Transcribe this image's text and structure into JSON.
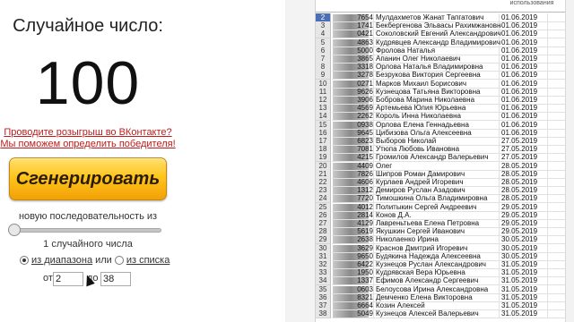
{
  "left": {
    "title": "Случайное число:",
    "result": "100",
    "link1": "Проводите розыгрыш во ВКонтакте?",
    "link2": "Мы поможем определить победителя!",
    "generate_label": "Сгенерировать",
    "sequence_label": "новую последовательность из",
    "count_label": "1 случайного числа",
    "radio_range_label": "из диапазона",
    "radio_or": "или",
    "radio_list_label": "из списка",
    "from_label": "от",
    "from_value": "2",
    "to_label": "до",
    "to_value": "38"
  },
  "sheet": {
    "header_date": "использования",
    "rows": [
      {
        "n": "2",
        "code": "7654",
        "name": "Мулдахметов Жанат Тапгатович",
        "date": "01.06.2019",
        "selected": true
      },
      {
        "n": "3",
        "code": "1741",
        "name": "Бекбергенова Эльвасы Рахимжановна",
        "date": "01.06.2019"
      },
      {
        "n": "4",
        "code": "0421",
        "name": "Соколовский Евгений Александрович",
        "date": "01.06.2019"
      },
      {
        "n": "5",
        "code": "4863",
        "name": "Кудрявцев Александр Владимирович",
        "date": "01.06.2019"
      },
      {
        "n": "6",
        "code": "5000",
        "name": "Фролова Наталья",
        "date": "01.06.2019"
      },
      {
        "n": "7",
        "code": "3865",
        "name": "Апанин Олег Николаевич",
        "date": "01.06.2019"
      },
      {
        "n": "8",
        "code": "3318",
        "name": "Орлова Наталья Владимировна",
        "date": "01.06.2019"
      },
      {
        "n": "9",
        "code": "3278",
        "name": "Безрукова Виктория Сергеевна",
        "date": "01.06.2019"
      },
      {
        "n": "10",
        "code": "0271",
        "name": "Марков Михаил Борисович",
        "date": "01.06.2019"
      },
      {
        "n": "11",
        "code": "9626",
        "name": "Кузнецова Татьяна Викторовна",
        "date": "01.06.2019"
      },
      {
        "n": "12",
        "code": "3906",
        "name": "Боброва Марина Николаевна",
        "date": "01.06.2019"
      },
      {
        "n": "13",
        "code": "4569",
        "name": "Артемьева Юлия Юрьевна",
        "date": "01.06.2019"
      },
      {
        "n": "14",
        "code": "2262",
        "name": "Король Инна Николаевна",
        "date": "01.06.2019"
      },
      {
        "n": "15",
        "code": "0938",
        "name": "Орлова Елена Геннадьевна",
        "date": "01.06.2019"
      },
      {
        "n": "16",
        "code": "9645",
        "name": "Цибизова Ольга Алексеевна",
        "date": "01.06.2019"
      },
      {
        "n": "17",
        "code": "6823",
        "name": "Выборов Николай",
        "date": "27.05.2019"
      },
      {
        "n": "18",
        "code": "7081",
        "name": "Утюпа Любовь Ивановна",
        "date": "27.05.2019"
      },
      {
        "n": "19",
        "code": "4215",
        "name": "Громилов Александр Валерьевич",
        "date": "27.05.2019"
      },
      {
        "n": "20",
        "code": "4409",
        "name": "Олег",
        "date": "28.05.2019"
      },
      {
        "n": "21",
        "code": "7826",
        "name": "Шипров Роман Дамирович",
        "date": "28.05.2019"
      },
      {
        "n": "22",
        "code": "4606",
        "name": "Курлаев Андрей Игоревич",
        "date": "28.05.2019"
      },
      {
        "n": "23",
        "code": "1312",
        "name": "Демиров Руслан Азадович",
        "date": "28.05.2019"
      },
      {
        "n": "24",
        "code": "7720",
        "name": "Тимошкина Ольга Владимировна",
        "date": "28.05.2019"
      },
      {
        "n": "25",
        "code": "4012",
        "name": "Политыкин Сергей Андреевич",
        "date": "29.05.2019"
      },
      {
        "n": "26",
        "code": "2814",
        "name": "Конов Д.А.",
        "date": "29.05.2019"
      },
      {
        "n": "27",
        "code": "4129",
        "name": "Лавреньтьева Елена Петровна",
        "date": "29.05.2019"
      },
      {
        "n": "28",
        "code": "5619",
        "name": "Якушкин Сергей Иванович",
        "date": "29.05.2019"
      },
      {
        "n": "29",
        "code": "2638",
        "name": "Николаенко Ирина",
        "date": "30.05.2019"
      },
      {
        "n": "30",
        "code": "3629",
        "name": "Краснов Дмитрий Игоревич",
        "date": "30.05.2019"
      },
      {
        "n": "31",
        "code": "9650",
        "name": "Будякина Надежда Алексеевна",
        "date": "30.05.2019"
      },
      {
        "n": "32",
        "code": "6422",
        "name": "Кузнецов Руслан Александрович",
        "date": "31.05.2019"
      },
      {
        "n": "33",
        "code": "1950",
        "name": "Кудрявская Вера Юрьевна",
        "date": "31.05.2019"
      },
      {
        "n": "34",
        "code": "1337",
        "name": "Ефимов Александр Сергеевич",
        "date": "31.05.2019"
      },
      {
        "n": "35",
        "code": "0603",
        "name": "Белоусова Ирина Александровна",
        "date": "31.05.2019"
      },
      {
        "n": "36",
        "code": "8321",
        "name": "Демченко Елена Викторовна",
        "date": "31.05.2019"
      },
      {
        "n": "37",
        "code": "6664",
        "name": "Козин Алексей",
        "date": "31.05.2019"
      },
      {
        "n": "38",
        "code": "5049",
        "name": "Кузнецов Алексей Валерьевич",
        "date": "31.05.2019"
      }
    ]
  }
}
